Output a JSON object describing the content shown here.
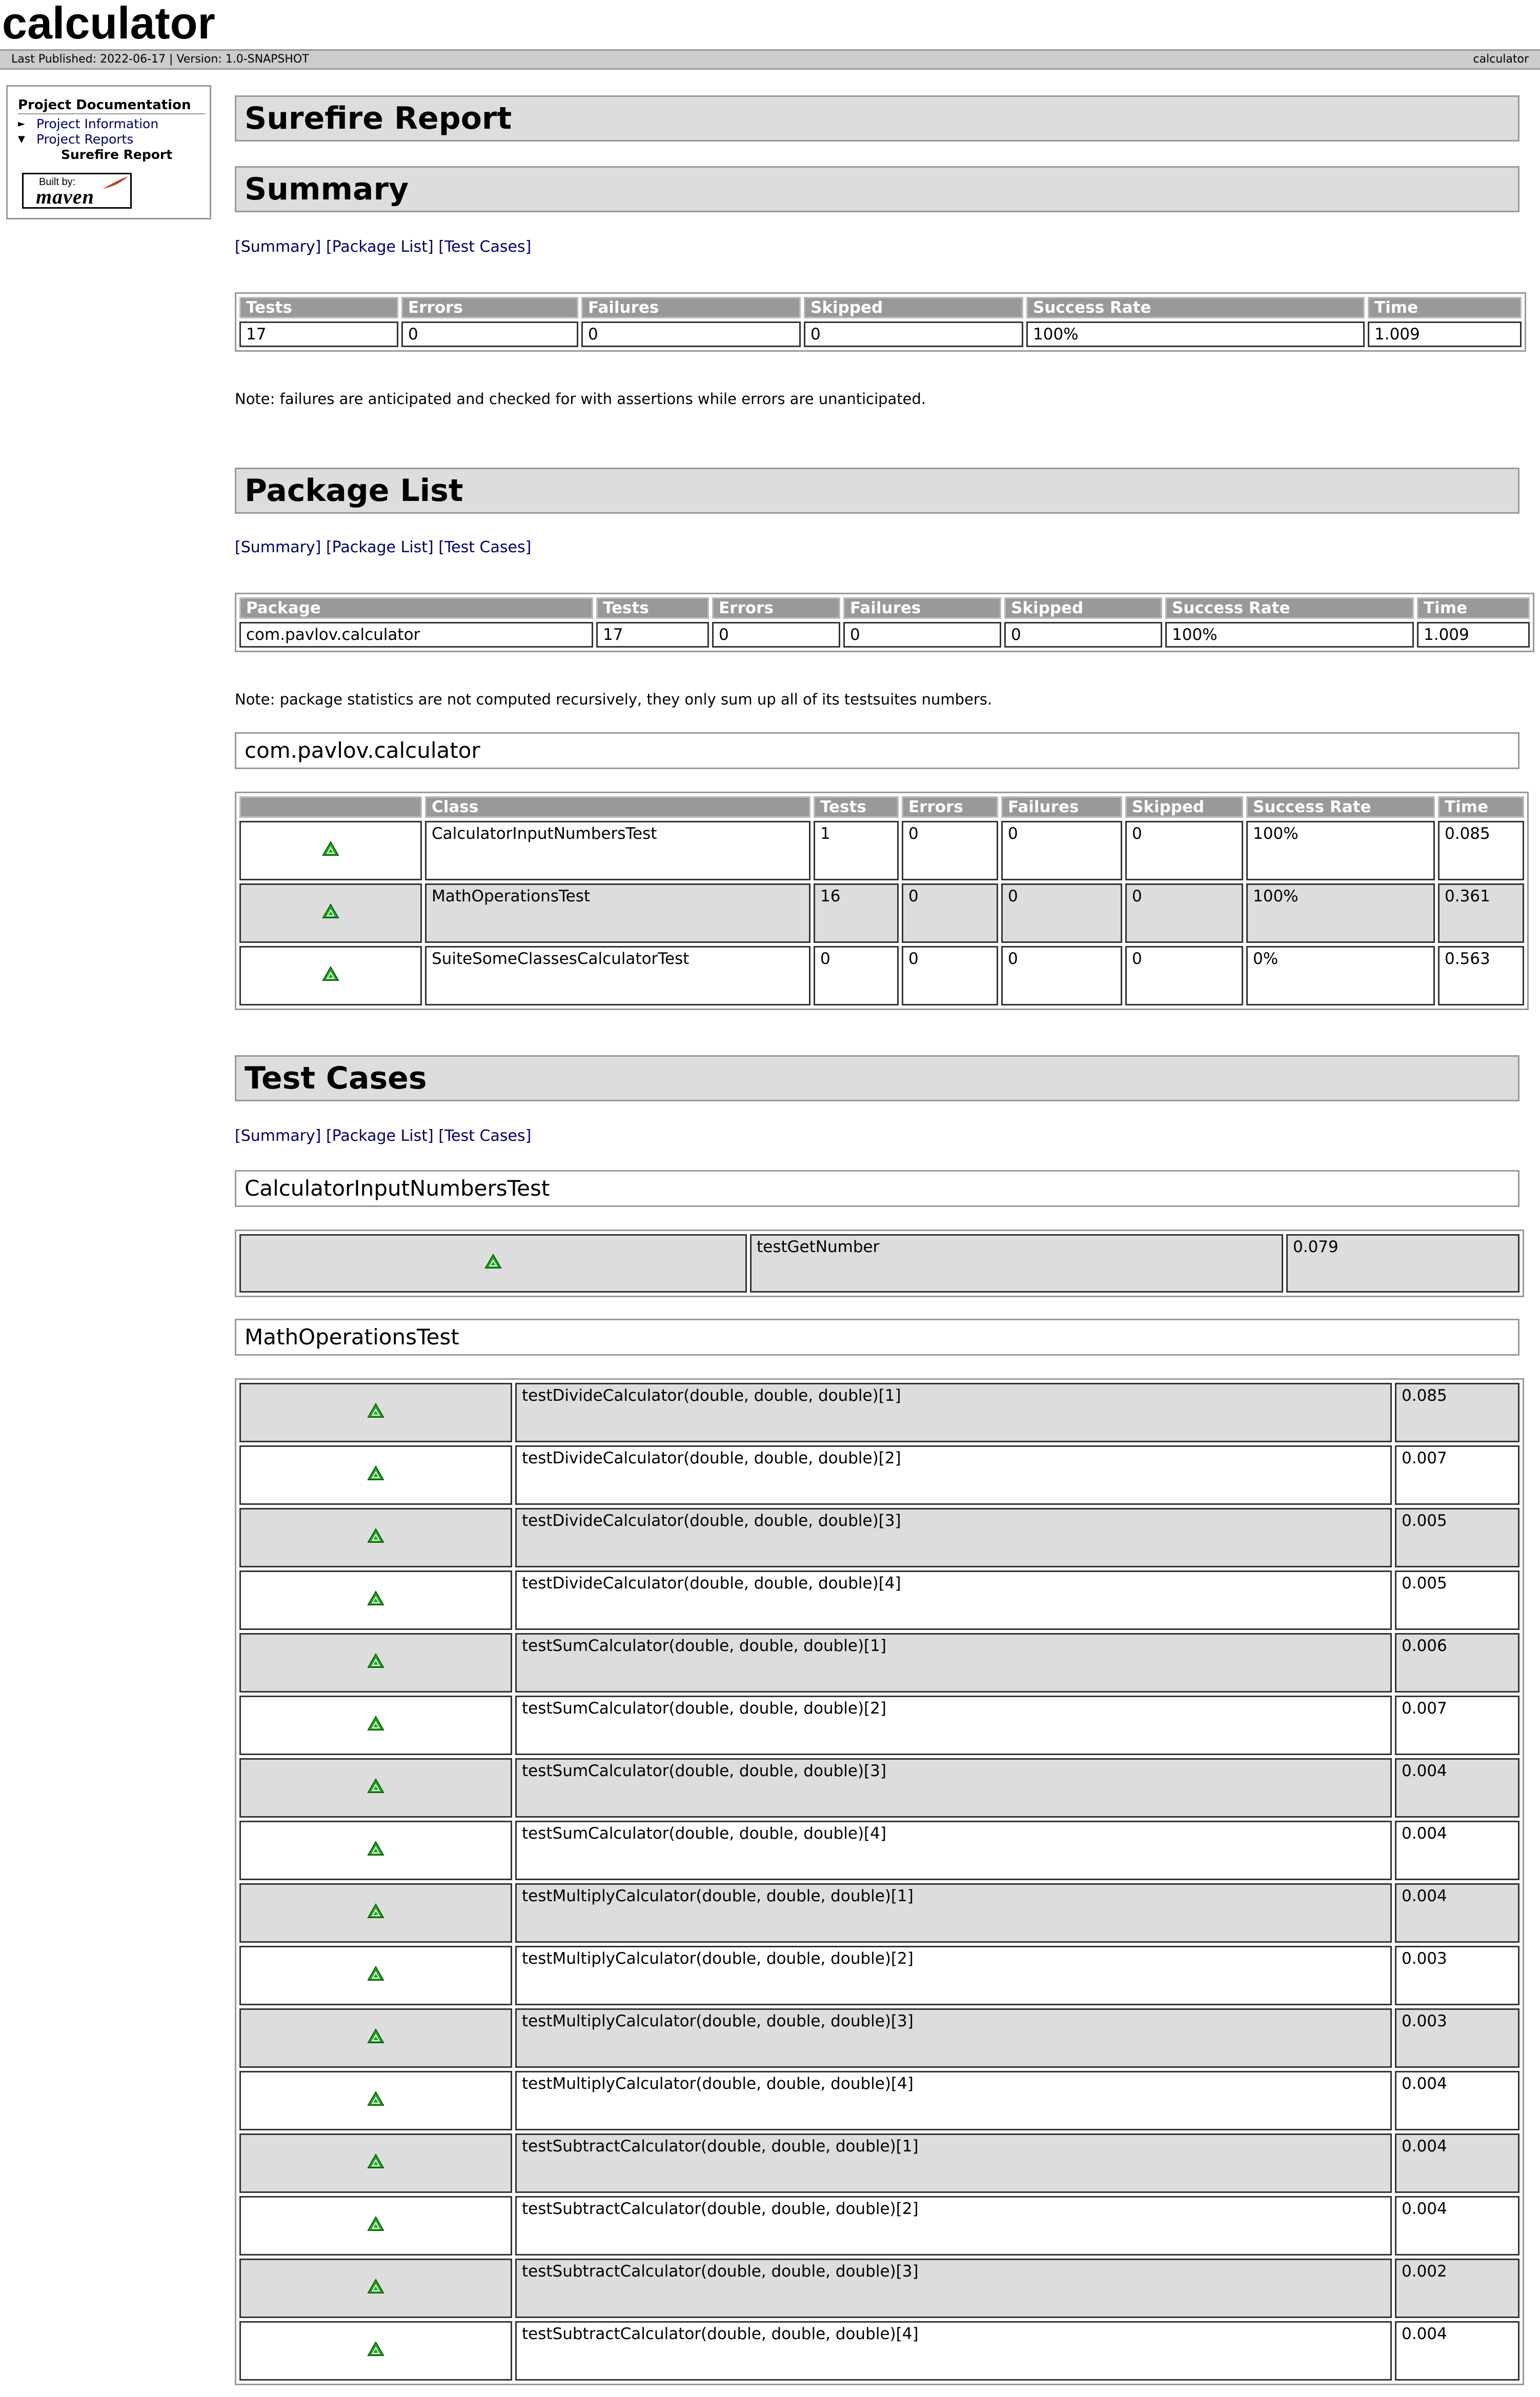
{
  "banner": {
    "title": "calculator"
  },
  "breadcrumbs": {
    "published": "Last Published: 2022-06-17",
    "separator": "|",
    "version": "Version: 1.0-SNAPSHOT",
    "right": "calculator"
  },
  "nav": {
    "heading": "Project Documentation",
    "items": [
      "Project Information",
      "Project Reports"
    ],
    "selected": "Surefire Report",
    "built_by": "Built by:",
    "maven": "maven"
  },
  "headings": {
    "report": "Surefire Report",
    "summary": "Summary",
    "package_list": "Package List",
    "test_cases": "Test Cases"
  },
  "links": {
    "summary": "[Summary]",
    "package_list": "[Package List]",
    "test_cases": "[Test Cases]"
  },
  "summary": {
    "headers": [
      "Tests",
      "Errors",
      "Failures",
      "Skipped",
      "Success Rate",
      "Time"
    ],
    "row": [
      "17",
      "0",
      "0",
      "0",
      "100%",
      "1.009"
    ],
    "note": "Note: failures are anticipated and checked for with assertions while errors are unanticipated."
  },
  "packages": {
    "headers": [
      "Package",
      "Tests",
      "Errors",
      "Failures",
      "Skipped",
      "Success Rate",
      "Time"
    ],
    "row": [
      "com.pavlov.calculator",
      "17",
      "0",
      "0",
      "0",
      "100%",
      "1.009"
    ],
    "note": "Note: package statistics are not computed recursively, they only sum up all of its testsuites numbers."
  },
  "package_detail": {
    "name": "com.pavlov.calculator",
    "headers": [
      "",
      "Class",
      "Tests",
      "Errors",
      "Failures",
      "Skipped",
      "Success Rate",
      "Time"
    ],
    "rows": [
      [
        "CalculatorInputNumbersTest",
        "1",
        "0",
        "0",
        "0",
        "100%",
        "0.085"
      ],
      [
        "MathOperationsTest",
        "16",
        "0",
        "0",
        "0",
        "100%",
        "0.361"
      ],
      [
        "SuiteSomeClassesCalculatorTest",
        "0",
        "0",
        "0",
        "0",
        "0%",
        "0.563"
      ]
    ]
  },
  "test_cases": {
    "suites": [
      {
        "name": "CalculatorInputNumbersTest",
        "cases": [
          [
            "testGetNumber",
            "0.079"
          ]
        ]
      },
      {
        "name": "MathOperationsTest",
        "cases": [
          [
            "testDivideCalculator(double, double, double)[1]",
            "0.085"
          ],
          [
            "testDivideCalculator(double, double, double)[2]",
            "0.007"
          ],
          [
            "testDivideCalculator(double, double, double)[3]",
            "0.005"
          ],
          [
            "testDivideCalculator(double, double, double)[4]",
            "0.005"
          ],
          [
            "testSumCalculator(double, double, double)[1]",
            "0.006"
          ],
          [
            "testSumCalculator(double, double, double)[2]",
            "0.007"
          ],
          [
            "testSumCalculator(double, double, double)[3]",
            "0.004"
          ],
          [
            "testSumCalculator(double, double, double)[4]",
            "0.004"
          ],
          [
            "testMultiplyCalculator(double, double, double)[1]",
            "0.004"
          ],
          [
            "testMultiplyCalculator(double, double, double)[2]",
            "0.003"
          ],
          [
            "testMultiplyCalculator(double, double, double)[3]",
            "0.003"
          ],
          [
            "testMultiplyCalculator(double, double, double)[4]",
            "0.004"
          ],
          [
            "testSubtractCalculator(double, double, double)[1]",
            "0.004"
          ],
          [
            "testSubtractCalculator(double, double, double)[2]",
            "0.004"
          ],
          [
            "testSubtractCalculator(double, double, double)[3]",
            "0.002"
          ],
          [
            "testSubtractCalculator(double, double, double)[4]",
            "0.004"
          ]
        ]
      }
    ]
  },
  "colors": {
    "header_bg": "#999999",
    "alt_row": "#dddddd",
    "icon_green": "#22aa22"
  },
  "icons": {
    "status": "success-icon",
    "expanded": "triangle-down-icon",
    "collapsed": "triangle-right-icon"
  }
}
